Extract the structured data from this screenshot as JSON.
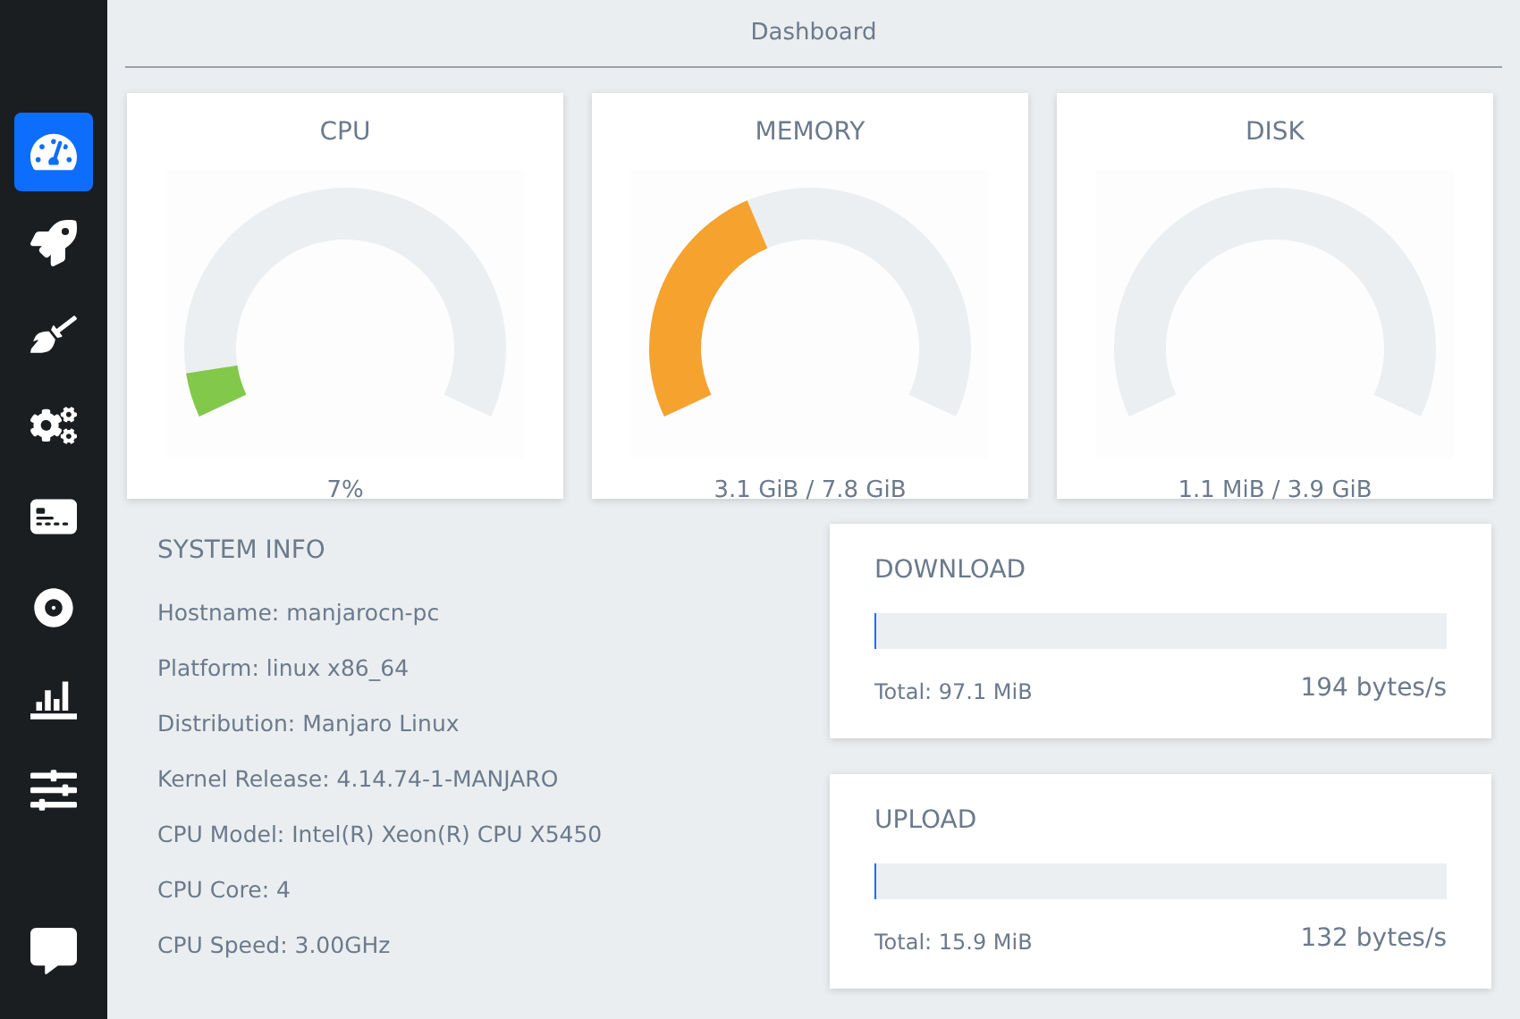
{
  "sidebar": {
    "items": [
      {
        "kind": "gauge",
        "selected": true
      },
      {
        "kind": "rocket",
        "selected": false
      },
      {
        "kind": "broom",
        "selected": false
      },
      {
        "kind": "gears",
        "selected": false
      },
      {
        "kind": "card",
        "selected": false
      },
      {
        "kind": "disk",
        "selected": false
      },
      {
        "kind": "chart",
        "selected": false
      },
      {
        "kind": "sliders",
        "selected": false
      }
    ],
    "bottom": {
      "kind": "chat",
      "selected": false
    }
  },
  "header": {
    "title": "Dashboard"
  },
  "gauges": [
    {
      "label": "CPU",
      "level": 0.07,
      "color": "#82c84a",
      "reading": "7%"
    },
    {
      "label": "MEMORY",
      "level": 0.4,
      "color": "#f5a22f",
      "reading": "3.1 GiB / 7.8 GiB"
    },
    {
      "label": "DISK",
      "level": 0,
      "reading": "1.1 MiB / 3.9 GiB"
    }
  ],
  "system_info": {
    "title": "SYSTEM INFO",
    "lines": [
      "Hostname: manjarocn-pc",
      "Platform: linux x86_64",
      "Distribution: Manjaro Linux",
      "Kernel Release: 4.14.74-1-MANJARO",
      "CPU Model: Intel(R) Xeon(R) CPU X5450",
      "CPU Core: 4",
      "CPU Speed: 3.00GHz"
    ]
  },
  "network": [
    {
      "title": "DOWNLOAD",
      "level": 0,
      "total": "Total: 97.1 MiB",
      "rate": "194 bytes/s"
    },
    {
      "title": "UPLOAD",
      "level": 0,
      "total": "Total: 15.9 MiB",
      "rate": "132 bytes/s"
    }
  ]
}
